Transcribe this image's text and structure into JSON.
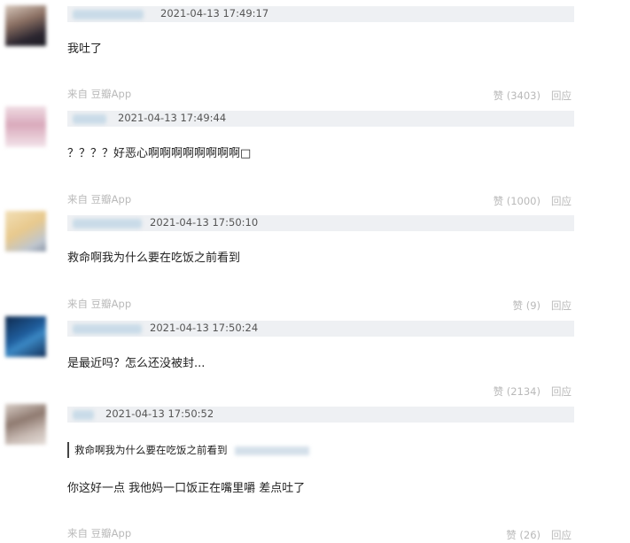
{
  "comments": [
    {
      "time": "2021-04-13 17:49:17",
      "text": "我吐了",
      "source": "来自 豆瓣App",
      "like": "赞 (3403)",
      "reply": "回应"
    },
    {
      "time": "2021-04-13 17:49:44",
      "text": "？？？？好恶心啊啊啊啊啊啊啊啊□",
      "source": "来自 豆瓣App",
      "like": "赞 (1000)",
      "reply": "回应"
    },
    {
      "time": "2021-04-13 17:50:10",
      "text": "救命啊我为什么要在吃饭之前看到",
      "source": "来自 豆瓣App",
      "like": "赞 (9)",
      "reply": "回应"
    },
    {
      "time": "2021-04-13 17:50:24",
      "text": "是最近吗？怎么还没被封...",
      "like": "赞 (2134)",
      "reply": "回应"
    },
    {
      "time": "2021-04-13 17:50:52",
      "quote": "救命啊我为什么要在吃饭之前看到",
      "text": "你这好一点 我他妈一口饭正在嘴里嚼 差点吐了",
      "source": "来自 豆瓣App",
      "like": "赞 (26)",
      "reply": "回应"
    }
  ]
}
